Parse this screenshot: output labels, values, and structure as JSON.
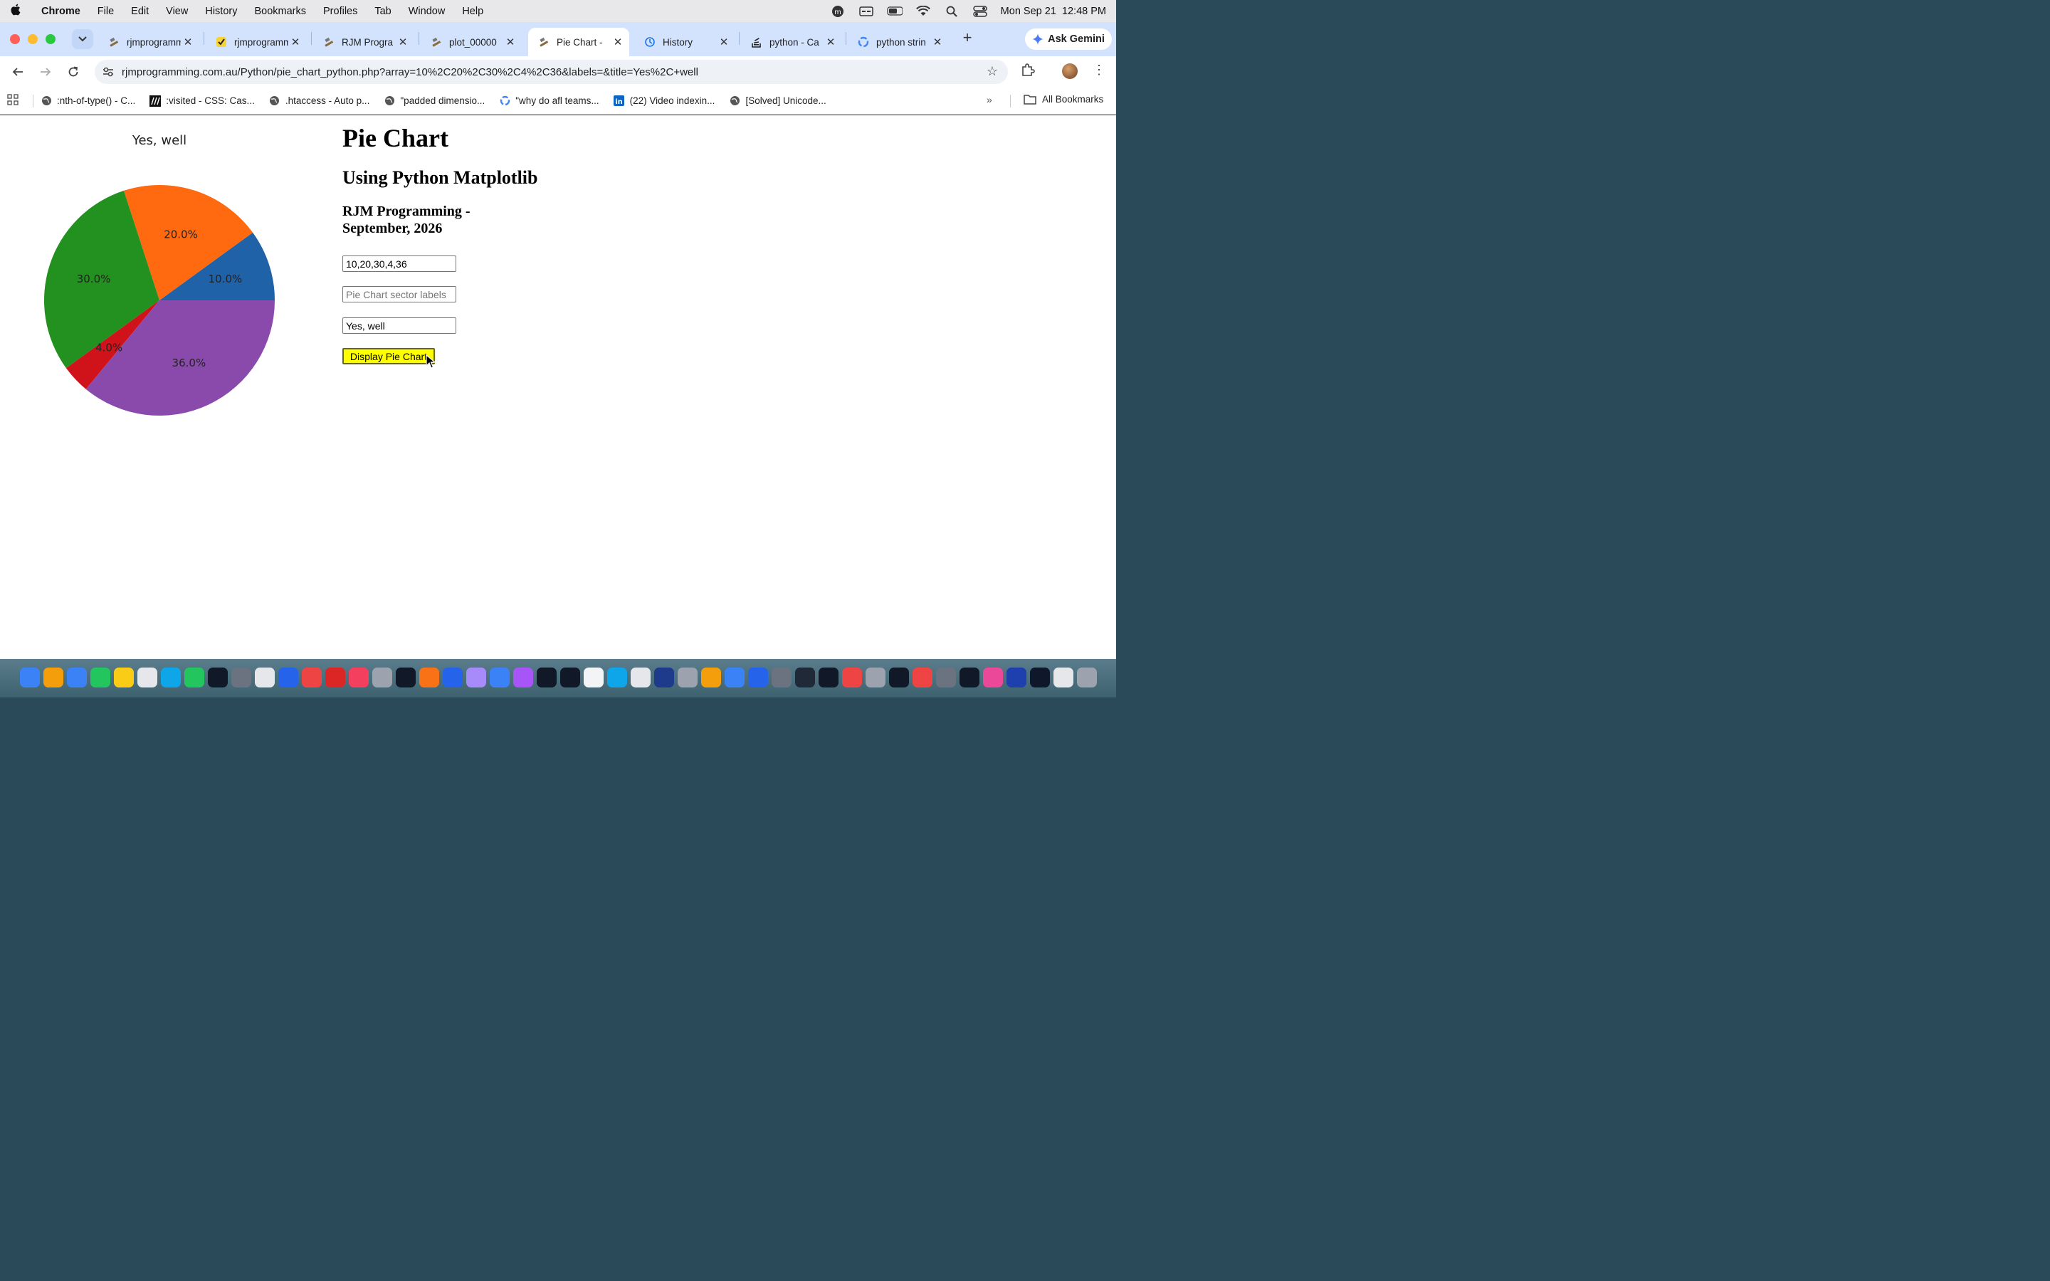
{
  "menubar": {
    "app": "Chrome",
    "items": [
      "File",
      "Edit",
      "View",
      "History",
      "Bookmarks",
      "Profiles",
      "Tab",
      "Window",
      "Help"
    ],
    "clock": "Mon Sep 21  12:48 PM"
  },
  "tabs": [
    {
      "title": "rjmprogramm",
      "icon": "hammer-icon",
      "active": false
    },
    {
      "title": "rjmprogramm",
      "icon": "check-icon",
      "active": false
    },
    {
      "title": "RJM Progra",
      "icon": "hammer-icon",
      "active": false
    },
    {
      "title": "plot_00000",
      "icon": "hammer-icon",
      "active": false
    },
    {
      "title": "Pie Chart - ",
      "icon": "hammer-icon",
      "active": true
    },
    {
      "title": "History",
      "icon": "history-icon",
      "active": false
    },
    {
      "title": "python - Ca",
      "icon": "stackoverflow-icon",
      "active": false
    },
    {
      "title": "python strin",
      "icon": "google-icon",
      "active": false
    }
  ],
  "gemini_label": "Ask Gemini",
  "address": {
    "url": "rjmprogramming.com.au/Python/pie_chart_python.php?array=10%2C20%2C30%2C4%2C36&labels=&title=Yes%2C+well"
  },
  "bookmarks": [
    {
      "label": ":nth-of-type() - C...",
      "icon": "globe-icon"
    },
    {
      "label": ":visited - CSS: Cas...",
      "icon": "mdn-icon"
    },
    {
      "label": ".htaccess - Auto p...",
      "icon": "globe-icon"
    },
    {
      "label": "\"padded dimensio...",
      "icon": "globe-icon"
    },
    {
      "label": "\"why do afl teams...",
      "icon": "google-icon"
    },
    {
      "label": "(22) Video indexin...",
      "icon": "linkedin-icon"
    },
    {
      "label": "[Solved] Unicode...",
      "icon": "globe-icon"
    }
  ],
  "all_bookmarks": "All Bookmarks",
  "page": {
    "h1": "Pie Chart",
    "h2": "Using Python Matplotlib",
    "h3": "RJM Programming - September, 2026",
    "values_field": "10,20,30,4,36",
    "labels_placeholder": "Pie Chart sector labels",
    "title_field": "Yes, well",
    "button": "Display Pie Chart"
  },
  "chart_data": {
    "type": "pie",
    "title": "Yes, well",
    "values": [
      10,
      20,
      30,
      4,
      36
    ],
    "labels": [
      "10.0%",
      "20.0%",
      "30.0%",
      "4.0%",
      "36.0%"
    ],
    "colors": [
      "#1f62a8",
      "#ff6a10",
      "#22911f",
      "#d0131b",
      "#8a4aab"
    ]
  }
}
